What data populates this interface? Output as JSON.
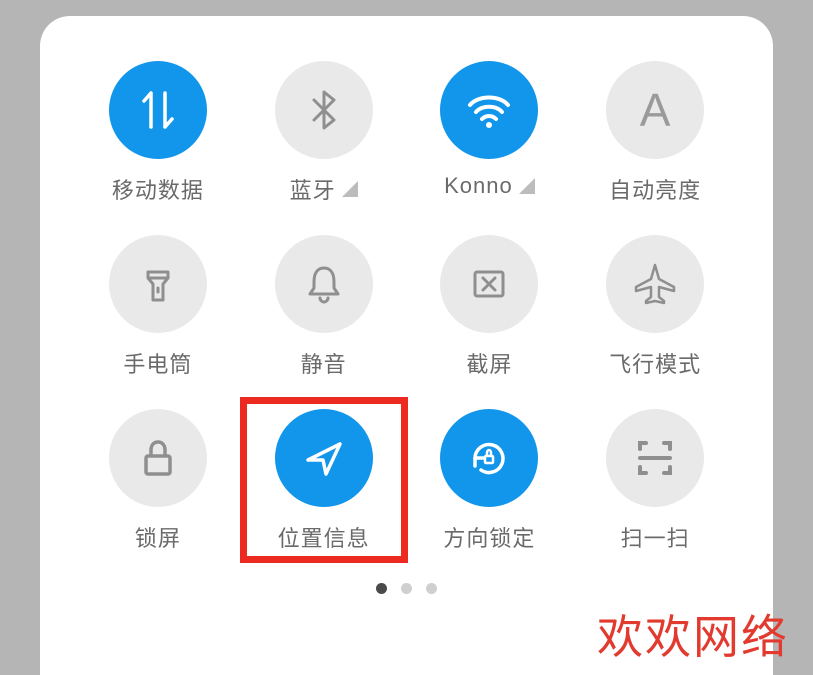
{
  "tiles": [
    {
      "id": "mobile-data",
      "label": "移动数据",
      "active": true
    },
    {
      "id": "bluetooth",
      "label": "蓝牙",
      "active": false,
      "signal": true
    },
    {
      "id": "wifi",
      "label": "Konno",
      "active": true,
      "signal": true
    },
    {
      "id": "auto-bright",
      "label": "自动亮度",
      "active": false
    },
    {
      "id": "flashlight",
      "label": "手电筒",
      "active": false
    },
    {
      "id": "mute",
      "label": "静音",
      "active": false
    },
    {
      "id": "screenshot",
      "label": "截屏",
      "active": false
    },
    {
      "id": "airplane",
      "label": "飞行模式",
      "active": false
    },
    {
      "id": "lock",
      "label": "锁屏",
      "active": false
    },
    {
      "id": "location",
      "label": "位置信息",
      "active": true,
      "highlighted": true
    },
    {
      "id": "rotation-lock",
      "label": "方向锁定",
      "active": true
    },
    {
      "id": "scan",
      "label": "扫一扫",
      "active": false
    }
  ],
  "pager": {
    "current": 0,
    "total": 3
  },
  "watermark": "欢欢网络"
}
